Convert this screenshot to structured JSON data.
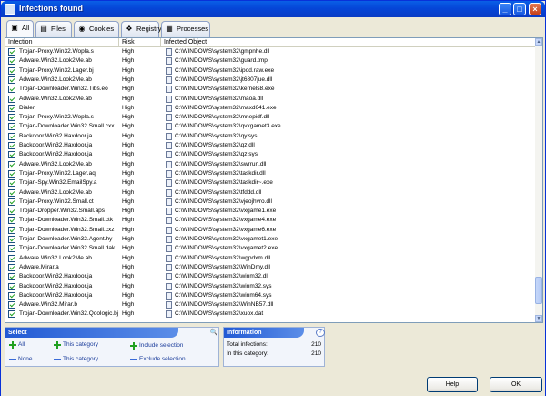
{
  "window": {
    "title": "Infections found",
    "min_icon": "minimize-icon",
    "max_icon": "maximize-icon",
    "close_icon": "close-icon"
  },
  "tabs": [
    {
      "label": "All",
      "icon": "monitor-icon",
      "active": true
    },
    {
      "label": "Files",
      "icon": "file-icon",
      "active": false
    },
    {
      "label": "Cookies",
      "icon": "cookie-icon",
      "active": false
    },
    {
      "label": "Registry",
      "icon": "registry-icon",
      "active": false
    },
    {
      "label": "Processes",
      "icon": "process-icon",
      "active": false
    }
  ],
  "columns": {
    "infection": "Infection",
    "risk": "Risk",
    "object": "Infected Object"
  },
  "rows": [
    {
      "name": "Trojan-Proxy.Win32.Wopla.s",
      "risk": "High",
      "object": "C:\\WINDOWS\\system32\\gmpnhe.dll"
    },
    {
      "name": "Adware.Win32.Look2Me.ab",
      "risk": "High",
      "object": "C:\\WINDOWS\\system32\\guard.tmp"
    },
    {
      "name": "Trojan-Proxy.Win32.Lager.bj",
      "risk": "High",
      "object": "C:\\WINDOWS\\system32\\ipod.raw.exe"
    },
    {
      "name": "Adware.Win32.Look2Me.ab",
      "risk": "High",
      "object": "C:\\WINDOWS\\system32\\jt6807jue.dll"
    },
    {
      "name": "Trojan-Downloader.Win32.Tibs.eo",
      "risk": "High",
      "object": "C:\\WINDOWS\\system32\\kernels8.exe"
    },
    {
      "name": "Adware.Win32.Look2Me.ab",
      "risk": "High",
      "object": "C:\\WINDOWS\\system32\\maoa.dll"
    },
    {
      "name": "Dialer",
      "risk": "High",
      "object": "C:\\WINDOWS\\system32\\maxd641.exe"
    },
    {
      "name": "Trojan-Proxy.Win32.Wopla.s",
      "risk": "High",
      "object": "C:\\WINDOWS\\system32\\mnepidf.dll"
    },
    {
      "name": "Trojan-Downloader.Win32.Small.cxx",
      "risk": "High",
      "object": "C:\\WINDOWS\\system32\\qvxgamet3.exe"
    },
    {
      "name": "Backdoor.Win32.Haxdoor.ja",
      "risk": "High",
      "object": "C:\\WINDOWS\\system32\\qy.sys"
    },
    {
      "name": "Backdoor.Win32.Haxdoor.ja",
      "risk": "High",
      "object": "C:\\WINDOWS\\system32\\qz.dll"
    },
    {
      "name": "Backdoor.Win32.Haxdoor.ja",
      "risk": "High",
      "object": "C:\\WINDOWS\\system32\\qz.sys"
    },
    {
      "name": "Adware.Win32.Look2Me.ab",
      "risk": "High",
      "object": "C:\\WINDOWS\\system32\\swrrun.dll"
    },
    {
      "name": "Trojan-Proxy.Win32.Lager.aq",
      "risk": "High",
      "object": "C:\\WINDOWS\\system32\\taskdir.dll"
    },
    {
      "name": "Trojan-Spy.Win32.EmailSpy.a",
      "risk": "High",
      "object": "C:\\WINDOWS\\system32\\taskdir~.exe"
    },
    {
      "name": "Adware.Win32.Look2Me.ab",
      "risk": "High",
      "object": "C:\\WINDOWS\\system32\\tfddd.dll"
    },
    {
      "name": "Trojan-Proxy.Win32.Small.ct",
      "risk": "High",
      "object": "C:\\WINDOWS\\system32\\vjeojhvro.dll"
    },
    {
      "name": "Trojan-Dropper.Win32.Small.aps",
      "risk": "High",
      "object": "C:\\WINDOWS\\system32\\vxgame1.exe"
    },
    {
      "name": "Trojan-Downloader.Win32.Small.ctk",
      "risk": "High",
      "object": "C:\\WINDOWS\\system32\\vxgame4.exe"
    },
    {
      "name": "Trojan-Downloader.Win32.Small.cxz",
      "risk": "High",
      "object": "C:\\WINDOWS\\system32\\vxgame6.exe"
    },
    {
      "name": "Trojan-Downloader.Win32.Agent.hy",
      "risk": "High",
      "object": "C:\\WINDOWS\\system32\\vxgamet1.exe"
    },
    {
      "name": "Trojan-Downloader.Win32.Small.dak",
      "risk": "High",
      "object": "C:\\WINDOWS\\system32\\vxgamet2.exe"
    },
    {
      "name": "Adware.Win32.Look2Me.ab",
      "risk": "High",
      "object": "C:\\WINDOWS\\system32\\wgpdxm.dll"
    },
    {
      "name": "Adware.Mirar.a",
      "risk": "High",
      "object": "C:\\WINDOWS\\system32\\WinDmy.dll"
    },
    {
      "name": "Backdoor.Win32.Haxdoor.ja",
      "risk": "High",
      "object": "C:\\WINDOWS\\system32\\winm32.dll"
    },
    {
      "name": "Backdoor.Win32.Haxdoor.ja",
      "risk": "High",
      "object": "C:\\WINDOWS\\system32\\winm32.sys"
    },
    {
      "name": "Backdoor.Win32.Haxdoor.ja",
      "risk": "High",
      "object": "C:\\WINDOWS\\system32\\winm64.sys"
    },
    {
      "name": "Adware.Win32.Mirar.b",
      "risk": "High",
      "object": "C:\\WINDOWS\\system32\\WinNB57.dll"
    },
    {
      "name": "Trojan-Downloader.Win32.Qoologic.bj",
      "risk": "High",
      "object": "C:\\WINDOWS\\system32\\xuox.dat"
    }
  ],
  "select": {
    "title": "Select",
    "all": "All",
    "this_category": "This category",
    "include": "Include selection",
    "none": "None",
    "this_category2": "This category",
    "exclude": "Exclude selection"
  },
  "info": {
    "title": "Information",
    "total_label": "Total infections:",
    "total_value": "210",
    "category_label": "In this category:",
    "category_value": "210"
  },
  "buttons": {
    "help": "Help",
    "ok": "OK"
  },
  "colors": {
    "title_bar": "#0546d8",
    "panel_header": "#225ad4",
    "check": "#21a121"
  }
}
